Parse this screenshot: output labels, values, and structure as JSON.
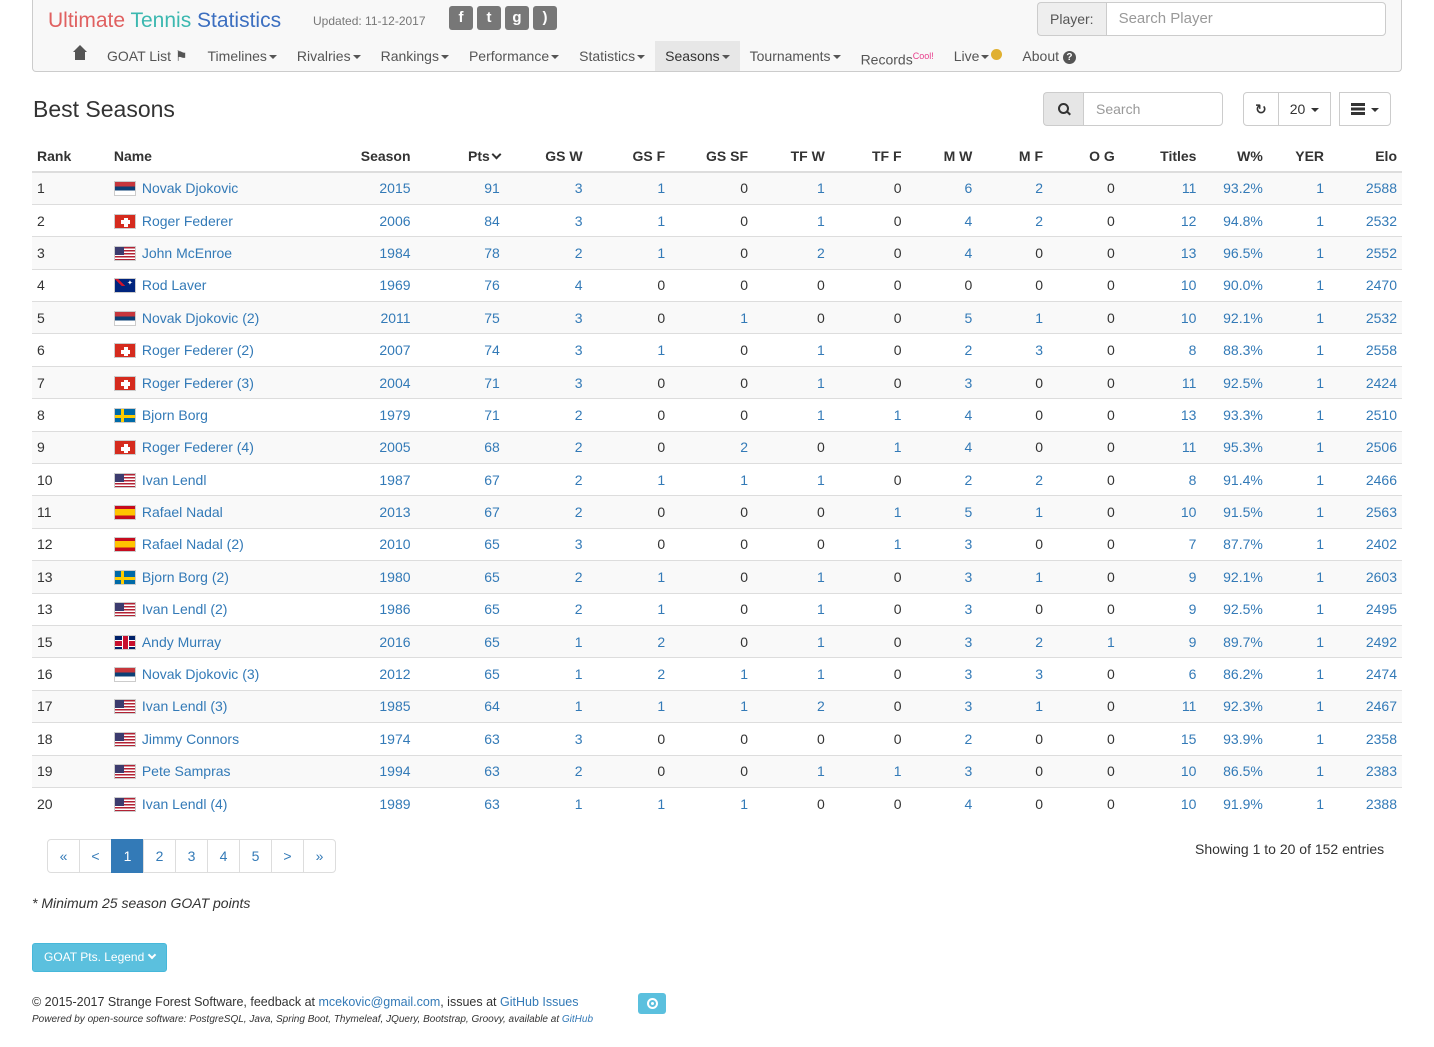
{
  "brand": {
    "part1": "Ultimate",
    "part2": "Tennis",
    "part3": "Statistics"
  },
  "updated": "Updated: 11-12-2017",
  "social": [
    {
      "name": "facebook-icon",
      "glyph": "f"
    },
    {
      "name": "twitter-icon",
      "glyph": "t"
    },
    {
      "name": "github-icon",
      "glyph": "g"
    },
    {
      "name": "rss-icon",
      "glyph": ")"
    }
  ],
  "player_search": {
    "label": "Player:",
    "placeholder": "Search Player"
  },
  "nav": {
    "goat_list": "GOAT List",
    "timelines": "Timelines",
    "rivalries": "Rivalries",
    "rankings": "Rankings",
    "performance": "Performance",
    "statistics": "Statistics",
    "seasons": "Seasons",
    "tournaments": "Tournaments",
    "records": "Records",
    "records_badge": "Cool!",
    "live": "Live",
    "about": "About"
  },
  "page_title": "Best Seasons",
  "search": {
    "placeholder": "Search"
  },
  "page_size": "20",
  "columns": [
    "Rank",
    "Name",
    "Season",
    "Pts",
    "GS W",
    "GS F",
    "GS SF",
    "TF W",
    "TF F",
    "M W",
    "M F",
    "O G",
    "Titles",
    "W%",
    "YER",
    "Elo"
  ],
  "rows": [
    {
      "rank": "1",
      "country": "srb",
      "name": "Novak Djokovic",
      "season": "2015",
      "pts": "91",
      "gsw": "3",
      "gsf": "1",
      "gssf": "0",
      "tfw": "1",
      "tff": "0",
      "mw": "6",
      "mf": "2",
      "og": "0",
      "titles": "11",
      "wpct": "93.2%",
      "yer": "1",
      "elo": "2588"
    },
    {
      "rank": "2",
      "country": "sui",
      "name": "Roger Federer",
      "season": "2006",
      "pts": "84",
      "gsw": "3",
      "gsf": "1",
      "gssf": "0",
      "tfw": "1",
      "tff": "0",
      "mw": "4",
      "mf": "2",
      "og": "0",
      "titles": "12",
      "wpct": "94.8%",
      "yer": "1",
      "elo": "2532"
    },
    {
      "rank": "3",
      "country": "usa",
      "name": "John McEnroe",
      "season": "1984",
      "pts": "78",
      "gsw": "2",
      "gsf": "1",
      "gssf": "0",
      "tfw": "2",
      "tff": "0",
      "mw": "4",
      "mf": "0",
      "og": "0",
      "titles": "13",
      "wpct": "96.5%",
      "yer": "1",
      "elo": "2552"
    },
    {
      "rank": "4",
      "country": "aus",
      "name": "Rod Laver",
      "season": "1969",
      "pts": "76",
      "gsw": "4",
      "gsf": "0",
      "gssf": "0",
      "tfw": "0",
      "tff": "0",
      "mw": "0",
      "mf": "0",
      "og": "0",
      "titles": "10",
      "wpct": "90.0%",
      "yer": "1",
      "elo": "2470"
    },
    {
      "rank": "5",
      "country": "srb",
      "name": "Novak Djokovic (2)",
      "season": "2011",
      "pts": "75",
      "gsw": "3",
      "gsf": "0",
      "gssf": "1",
      "tfw": "0",
      "tff": "0",
      "mw": "5",
      "mf": "1",
      "og": "0",
      "titles": "10",
      "wpct": "92.1%",
      "yer": "1",
      "elo": "2532"
    },
    {
      "rank": "6",
      "country": "sui",
      "name": "Roger Federer (2)",
      "season": "2007",
      "pts": "74",
      "gsw": "3",
      "gsf": "1",
      "gssf": "0",
      "tfw": "1",
      "tff": "0",
      "mw": "2",
      "mf": "3",
      "og": "0",
      "titles": "8",
      "wpct": "88.3%",
      "yer": "1",
      "elo": "2558"
    },
    {
      "rank": "7",
      "country": "sui",
      "name": "Roger Federer (3)",
      "season": "2004",
      "pts": "71",
      "gsw": "3",
      "gsf": "0",
      "gssf": "0",
      "tfw": "1",
      "tff": "0",
      "mw": "3",
      "mf": "0",
      "og": "0",
      "titles": "11",
      "wpct": "92.5%",
      "yer": "1",
      "elo": "2424"
    },
    {
      "rank": "8",
      "country": "swe",
      "name": "Bjorn Borg",
      "season": "1979",
      "pts": "71",
      "gsw": "2",
      "gsf": "0",
      "gssf": "0",
      "tfw": "1",
      "tff": "1",
      "mw": "4",
      "mf": "0",
      "og": "0",
      "titles": "13",
      "wpct": "93.3%",
      "yer": "1",
      "elo": "2510"
    },
    {
      "rank": "9",
      "country": "sui",
      "name": "Roger Federer (4)",
      "season": "2005",
      "pts": "68",
      "gsw": "2",
      "gsf": "0",
      "gssf": "2",
      "tfw": "0",
      "tff": "1",
      "mw": "4",
      "mf": "0",
      "og": "0",
      "titles": "11",
      "wpct": "95.3%",
      "yer": "1",
      "elo": "2506"
    },
    {
      "rank": "10",
      "country": "usa",
      "name": "Ivan Lendl",
      "season": "1987",
      "pts": "67",
      "gsw": "2",
      "gsf": "1",
      "gssf": "1",
      "tfw": "1",
      "tff": "0",
      "mw": "2",
      "mf": "2",
      "og": "0",
      "titles": "8",
      "wpct": "91.4%",
      "yer": "1",
      "elo": "2466"
    },
    {
      "rank": "11",
      "country": "esp",
      "name": "Rafael Nadal",
      "season": "2013",
      "pts": "67",
      "gsw": "2",
      "gsf": "0",
      "gssf": "0",
      "tfw": "0",
      "tff": "1",
      "mw": "5",
      "mf": "1",
      "og": "0",
      "titles": "10",
      "wpct": "91.5%",
      "yer": "1",
      "elo": "2563"
    },
    {
      "rank": "12",
      "country": "esp",
      "name": "Rafael Nadal (2)",
      "season": "2010",
      "pts": "65",
      "gsw": "3",
      "gsf": "0",
      "gssf": "0",
      "tfw": "0",
      "tff": "1",
      "mw": "3",
      "mf": "0",
      "og": "0",
      "titles": "7",
      "wpct": "87.7%",
      "yer": "1",
      "elo": "2402"
    },
    {
      "rank": "13",
      "country": "swe",
      "name": "Bjorn Borg (2)",
      "season": "1980",
      "pts": "65",
      "gsw": "2",
      "gsf": "1",
      "gssf": "0",
      "tfw": "1",
      "tff": "0",
      "mw": "3",
      "mf": "1",
      "og": "0",
      "titles": "9",
      "wpct": "92.1%",
      "yer": "1",
      "elo": "2603"
    },
    {
      "rank": "13",
      "country": "usa",
      "name": "Ivan Lendl (2)",
      "season": "1986",
      "pts": "65",
      "gsw": "2",
      "gsf": "1",
      "gssf": "0",
      "tfw": "1",
      "tff": "0",
      "mw": "3",
      "mf": "0",
      "og": "0",
      "titles": "9",
      "wpct": "92.5%",
      "yer": "1",
      "elo": "2495"
    },
    {
      "rank": "15",
      "country": "gbr",
      "name": "Andy Murray",
      "season": "2016",
      "pts": "65",
      "gsw": "1",
      "gsf": "2",
      "gssf": "0",
      "tfw": "1",
      "tff": "0",
      "mw": "3",
      "mf": "2",
      "og": "1",
      "titles": "9",
      "wpct": "89.7%",
      "yer": "1",
      "elo": "2492"
    },
    {
      "rank": "16",
      "country": "srb",
      "name": "Novak Djokovic (3)",
      "season": "2012",
      "pts": "65",
      "gsw": "1",
      "gsf": "2",
      "gssf": "1",
      "tfw": "1",
      "tff": "0",
      "mw": "3",
      "mf": "3",
      "og": "0",
      "titles": "6",
      "wpct": "86.2%",
      "yer": "1",
      "elo": "2474"
    },
    {
      "rank": "17",
      "country": "usa",
      "name": "Ivan Lendl (3)",
      "season": "1985",
      "pts": "64",
      "gsw": "1",
      "gsf": "1",
      "gssf": "1",
      "tfw": "2",
      "tff": "0",
      "mw": "3",
      "mf": "1",
      "og": "0",
      "titles": "11",
      "wpct": "92.3%",
      "yer": "1",
      "elo": "2467"
    },
    {
      "rank": "18",
      "country": "usa",
      "name": "Jimmy Connors",
      "season": "1974",
      "pts": "63",
      "gsw": "3",
      "gsf": "0",
      "gssf": "0",
      "tfw": "0",
      "tff": "0",
      "mw": "2",
      "mf": "0",
      "og": "0",
      "titles": "15",
      "wpct": "93.9%",
      "yer": "1",
      "elo": "2358"
    },
    {
      "rank": "19",
      "country": "usa",
      "name": "Pete Sampras",
      "season": "1994",
      "pts": "63",
      "gsw": "2",
      "gsf": "0",
      "gssf": "0",
      "tfw": "1",
      "tff": "1",
      "mw": "3",
      "mf": "0",
      "og": "0",
      "titles": "10",
      "wpct": "86.5%",
      "yer": "1",
      "elo": "2383"
    },
    {
      "rank": "20",
      "country": "usa",
      "name": "Ivan Lendl (4)",
      "season": "1989",
      "pts": "63",
      "gsw": "1",
      "gsf": "1",
      "gssf": "1",
      "tfw": "0",
      "tff": "0",
      "mw": "4",
      "mf": "0",
      "og": "0",
      "titles": "10",
      "wpct": "91.9%",
      "yer": "1",
      "elo": "2388"
    }
  ],
  "pagination": {
    "first": "«",
    "prev": "<",
    "pages": [
      "1",
      "2",
      "3",
      "4",
      "5"
    ],
    "active_page": "1",
    "next": ">",
    "last": "»"
  },
  "entries_info": "Showing 1 to 20 of 152 entries",
  "note": "* Minimum 25 season GOAT points",
  "legend_button": "GOAT Pts. Legend",
  "footer": {
    "copyright": "© 2015-2017 Strange Forest Software, feedback at",
    "email": "mcekovic@gmail.com",
    "issues_prefix": ", issues at",
    "issues_link": "GitHub Issues",
    "powered": "Powered by open-source software: PostgreSQL, Java, Spring Boot, Thymeleaf, JQuery, Bootstrap, Groovy, available at",
    "github": "GitHub"
  }
}
